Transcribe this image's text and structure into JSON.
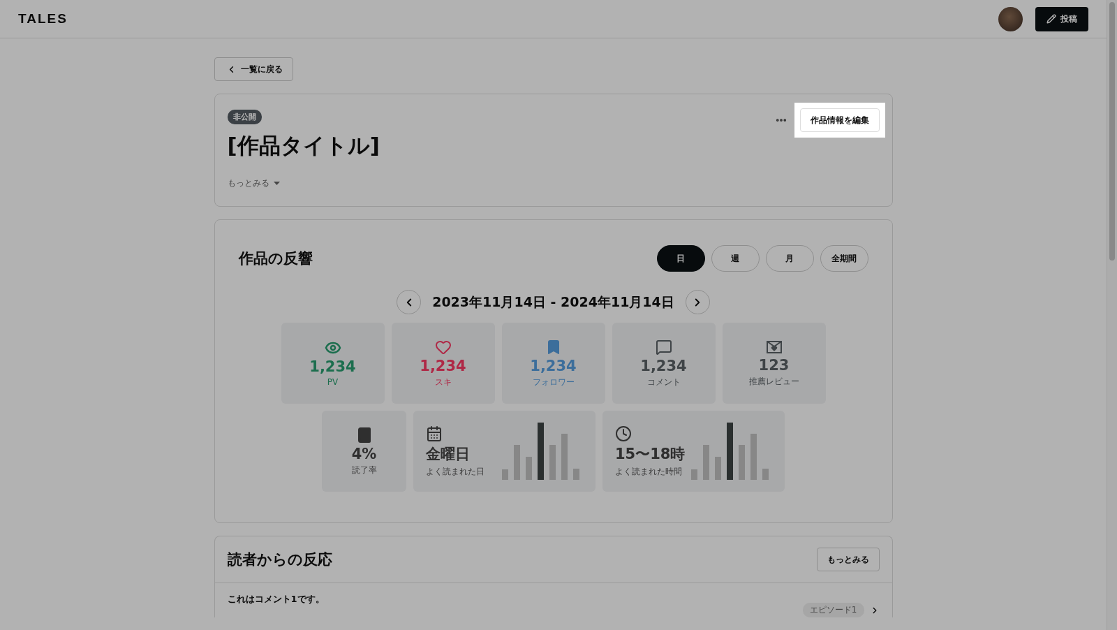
{
  "header": {
    "logo": "TALES",
    "post_button": "投稿"
  },
  "back_button": "一覧に戻る",
  "work": {
    "status_badge": "非公開",
    "title": "[作品タイトル]",
    "edit_button": "作品情報を編集",
    "more_toggle": "もっとみる"
  },
  "reactions": {
    "title": "作品の反響",
    "periods": [
      {
        "label": "日",
        "selected": true
      },
      {
        "label": "週",
        "selected": false
      },
      {
        "label": "月",
        "selected": false
      },
      {
        "label": "全期間",
        "selected": false
      }
    ],
    "date_range": "2023年11月14日 - 2024年11月14日",
    "stats": [
      {
        "kind": "views",
        "value": "1,234",
        "label": "PV",
        "color": "#1c6e4e"
      },
      {
        "kind": "likes",
        "value": "1,234",
        "label": "スキ",
        "color": "#af2846"
      },
      {
        "kind": "followers",
        "value": "1,234",
        "label": "フォロワー",
        "color": "#3c6e9b"
      },
      {
        "kind": "comments",
        "value": "1,234",
        "label": "コメント",
        "color": "#3f4447"
      },
      {
        "kind": "reviews",
        "value": "123",
        "label": "推薦レビュー",
        "color": "#3f4447"
      }
    ],
    "insights": [
      {
        "kind": "rate",
        "value": "4%",
        "label": "読了率"
      },
      {
        "kind": "day",
        "value": "金曜日",
        "label": "よく読まれた日"
      },
      {
        "kind": "time",
        "value": "15〜18時",
        "label": "よく読まれた時間"
      }
    ]
  },
  "reader_reactions": {
    "title": "読者からの反応",
    "more_button": "もっとみる",
    "comments": [
      {
        "text": "これはコメント1です。",
        "episode": "エピソード1"
      }
    ]
  }
}
